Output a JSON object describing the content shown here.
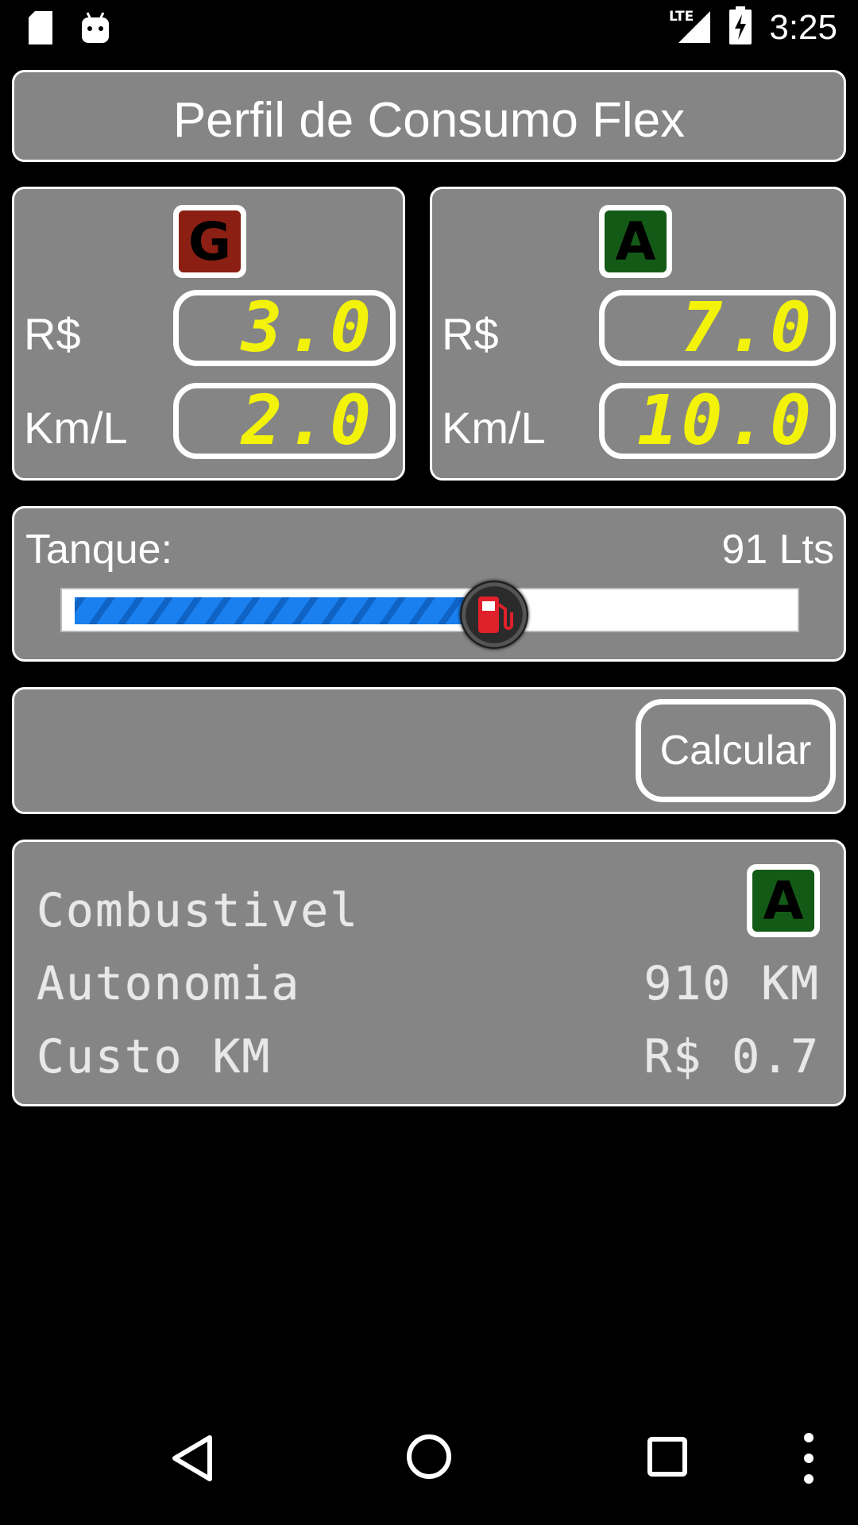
{
  "status_bar": {
    "time": "3:25",
    "network": "LTE",
    "icons": [
      "sd-card-icon",
      "android-icon",
      "lte-signal-icon",
      "battery-charging-icon"
    ]
  },
  "title": "Perfil de Consumo Flex",
  "fuels": {
    "gasoline": {
      "badge": "G",
      "badge_color": "#8b1f14",
      "price_label": "R$",
      "price": "3.0",
      "efficiency_label": "Km/L",
      "efficiency": "2.0"
    },
    "alcohol": {
      "badge": "A",
      "badge_color": "#145a17",
      "price_label": "R$",
      "price": "7.0",
      "efficiency_label": "Km/L",
      "efficiency": "10.0"
    }
  },
  "tank": {
    "label": "Tanque:",
    "value_text": "91 Lts",
    "level_fraction": 0.59,
    "thumb_icon": "fuel-pump-icon"
  },
  "calculate_button": "Calcular",
  "result": {
    "fuel_label": "Combustivel",
    "fuel_badge": "A",
    "fuel_badge_color": "#145a17",
    "autonomy_label": "Autonomia",
    "autonomy_value": "910 KM",
    "cost_label": "Custo KM",
    "cost_value": "R$ 0.7"
  },
  "nav": [
    "back-icon",
    "home-icon",
    "recents-icon",
    "overflow-menu-icon"
  ],
  "colors": {
    "panel": "#858585",
    "lcd_text": "#f2f20a",
    "slider_fill": "#1a80f0"
  }
}
